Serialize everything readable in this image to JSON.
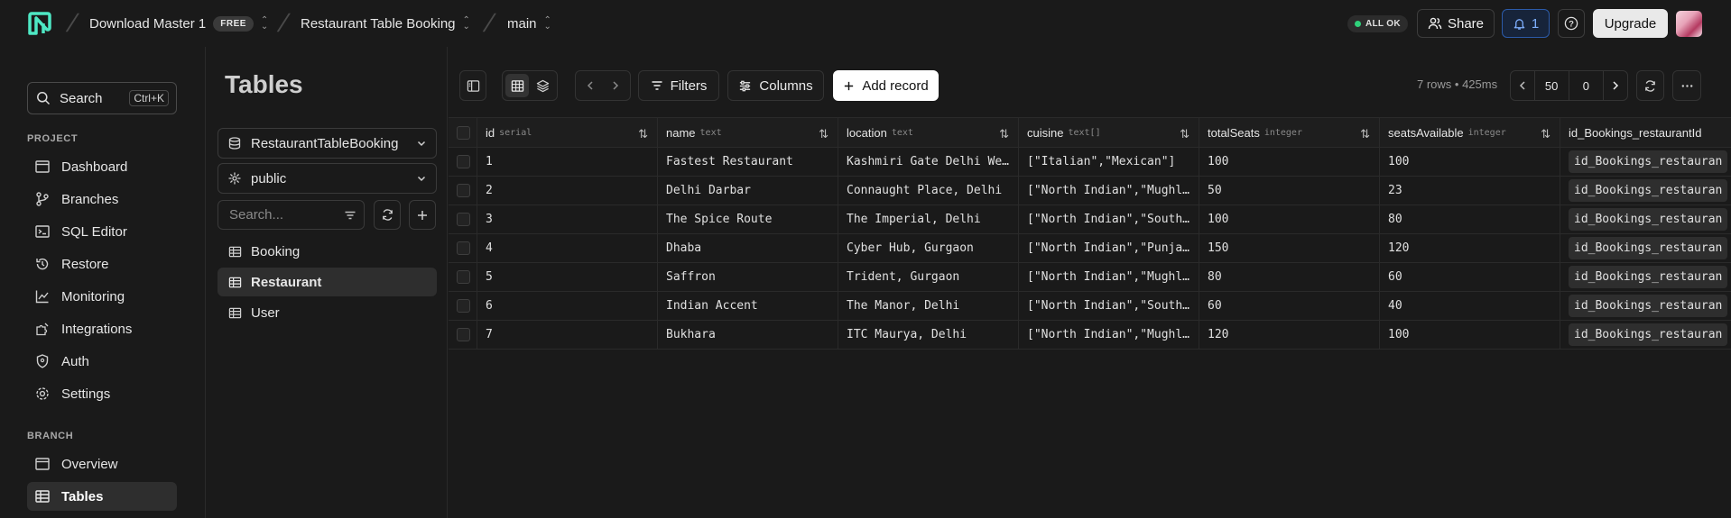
{
  "topbar": {
    "project": "Download Master 1",
    "plan_badge": "FREE",
    "database": "Restaurant Table Booking",
    "branch": "main",
    "status": "ALL OK",
    "share_label": "Share",
    "notifications_count": "1",
    "upgrade_label": "Upgrade",
    "colors": {
      "logo": "#4ee8c4",
      "status_dot": "#2fd17a",
      "notif_accent": "#2b5aa8"
    }
  },
  "sidebar": {
    "search_label": "Search",
    "search_shortcut": "Ctrl+K",
    "project_section": "PROJECT",
    "project_items": [
      {
        "label": "Dashboard",
        "icon": "dashboard-icon"
      },
      {
        "label": "Branches",
        "icon": "branch-icon"
      },
      {
        "label": "SQL Editor",
        "icon": "terminal-icon"
      },
      {
        "label": "Restore",
        "icon": "restore-icon"
      },
      {
        "label": "Monitoring",
        "icon": "chart-icon"
      },
      {
        "label": "Integrations",
        "icon": "puzzle-icon"
      },
      {
        "label": "Auth",
        "icon": "shield-icon"
      },
      {
        "label": "Settings",
        "icon": "gear-icon"
      }
    ],
    "branch_section": "BRANCH",
    "branch_items": [
      {
        "label": "Overview",
        "icon": "window-icon"
      },
      {
        "label": "Tables",
        "icon": "table-icon",
        "active": true
      }
    ]
  },
  "tables_panel": {
    "title": "Tables",
    "database_select": "RestaurantTableBooking",
    "schema_select": "public",
    "search_placeholder": "Search...",
    "tables": [
      {
        "label": "Booking"
      },
      {
        "label": "Restaurant",
        "active": true
      },
      {
        "label": "User"
      }
    ]
  },
  "toolbar": {
    "filters_label": "Filters",
    "columns_label": "Columns",
    "add_record_label": "Add record",
    "rows_info": "7 rows • 425ms",
    "page_size": "50",
    "offset": "0"
  },
  "grid": {
    "columns": [
      {
        "name": "id",
        "type": "serial"
      },
      {
        "name": "name",
        "type": "text"
      },
      {
        "name": "location",
        "type": "text"
      },
      {
        "name": "cuisine",
        "type": "text[]"
      },
      {
        "name": "totalSeats",
        "type": "integer"
      },
      {
        "name": "seatsAvailable",
        "type": "integer"
      },
      {
        "name": "id_Bookings_restaurantId",
        "type": ""
      }
    ],
    "rows": [
      [
        "1",
        "Fastest Restaurant",
        "Kashmiri Gate Delhi We…",
        "[\"Italian\",\"Mexican\"]",
        "100",
        "100",
        "id_Bookings_restauran"
      ],
      [
        "2",
        "Delhi Darbar",
        "Connaught Place, Delhi",
        "[\"North Indian\",\"Mughl…",
        "50",
        "23",
        "id_Bookings_restauran"
      ],
      [
        "3",
        "The Spice Route",
        "The Imperial, Delhi",
        "[\"North Indian\",\"South…",
        "100",
        "80",
        "id_Bookings_restauran"
      ],
      [
        "4",
        "Dhaba",
        "Cyber Hub, Gurgaon",
        "[\"North Indian\",\"Punja…",
        "150",
        "120",
        "id_Bookings_restauran"
      ],
      [
        "5",
        "Saffron",
        "Trident, Gurgaon",
        "[\"North Indian\",\"Mughl…",
        "80",
        "60",
        "id_Bookings_restauran"
      ],
      [
        "6",
        "Indian Accent",
        "The Manor, Delhi",
        "[\"North Indian\",\"South…",
        "60",
        "40",
        "id_Bookings_restauran"
      ],
      [
        "7",
        "Bukhara",
        "ITC Maurya, Delhi",
        "[\"North Indian\",\"Mughl…",
        "120",
        "100",
        "id_Bookings_restauran"
      ]
    ]
  }
}
